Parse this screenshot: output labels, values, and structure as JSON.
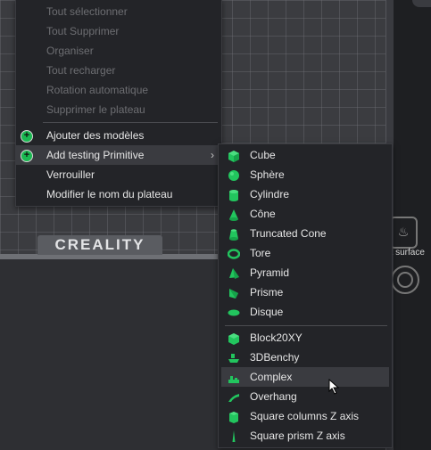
{
  "context_menu": {
    "items": [
      {
        "label": "Tout sélectionner",
        "enabled": false
      },
      {
        "label": "Tout Supprimer",
        "enabled": false
      },
      {
        "label": "Organiser",
        "enabled": false
      },
      {
        "label": "Tout recharger",
        "enabled": false
      },
      {
        "label": "Rotation automatique",
        "enabled": false
      },
      {
        "label": "Supprimer le plateau",
        "enabled": false
      },
      {
        "label": "Ajouter des modèles",
        "enabled": true,
        "icon": "add-model-icon"
      },
      {
        "label": "Add testing Primitive",
        "enabled": true,
        "icon": "add-primitive-icon",
        "submenu": true
      },
      {
        "label": "Verrouiller",
        "enabled": true
      },
      {
        "label": "Modifier le nom du plateau",
        "enabled": true
      }
    ]
  },
  "submenu": {
    "primitives": [
      {
        "label": "Cube",
        "icon": "cube-icon"
      },
      {
        "label": "Sphère",
        "icon": "sphere-icon"
      },
      {
        "label": "Cylindre",
        "icon": "cylinder-icon"
      },
      {
        "label": "Cône",
        "icon": "cone-icon"
      },
      {
        "label": "Truncated Cone",
        "icon": "truncated-cone-icon"
      },
      {
        "label": "Tore",
        "icon": "torus-icon"
      },
      {
        "label": "Pyramid",
        "icon": "pyramid-icon"
      },
      {
        "label": "Prisme",
        "icon": "prism-icon"
      },
      {
        "label": "Disque",
        "icon": "disk-icon"
      }
    ],
    "models": [
      {
        "label": "Block20XY",
        "icon": "block20xy-icon"
      },
      {
        "label": "3DBenchy",
        "icon": "benchy-icon"
      },
      {
        "label": "Complex",
        "icon": "complex-icon",
        "highlighted": true
      },
      {
        "label": "Overhang",
        "icon": "overhang-icon"
      },
      {
        "label": "Square columns Z axis",
        "icon": "square-columns-icon"
      },
      {
        "label": "Square prism Z axis",
        "icon": "square-prism-icon"
      }
    ]
  },
  "bed": {
    "brand": "CREALITY",
    "hot_surface_text": "ot surface"
  },
  "colors": {
    "menu_bg": "#232428",
    "primitive_green": "#22c55e",
    "add_icon_green": "#1ab851",
    "disabled_text": "#6d6e72",
    "highlight": "#3a3b40"
  }
}
